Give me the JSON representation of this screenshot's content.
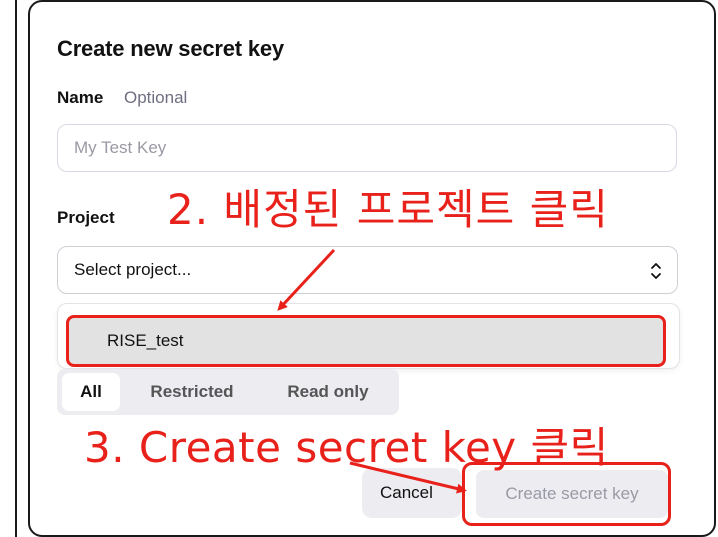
{
  "dialog": {
    "title": "Create new secret key",
    "name_label": "Name",
    "name_optional": "Optional",
    "name_placeholder": "My Test Key",
    "project_label": "Project",
    "project_select_value": "Select project...",
    "project_options": [
      "RISE_test"
    ],
    "permissions": {
      "tabs": [
        "All",
        "Restricted",
        "Read only"
      ],
      "selected": "All"
    },
    "cancel_label": "Cancel",
    "create_label": "Create secret key"
  },
  "annotations": {
    "step2": "2. 배정된 프로젝트 클릭",
    "step3": "3. Create secret key 클릭",
    "color": "#e8211b"
  }
}
